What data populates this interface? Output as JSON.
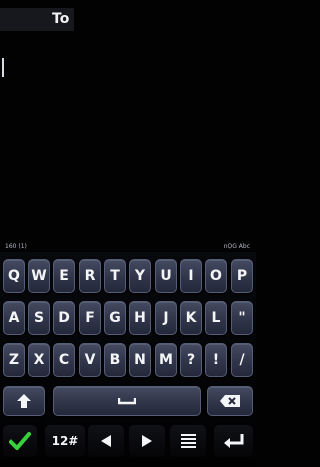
{
  "header": {
    "to_label": "To"
  },
  "keyboard": {
    "status_left": "160 (1)",
    "status_right": "nỌG Abc",
    "rows": [
      [
        "Q",
        "W",
        "E",
        "R",
        "T",
        "Y",
        "U",
        "I",
        "O",
        "P"
      ],
      [
        "A",
        "S",
        "D",
        "F",
        "G",
        "H",
        "J",
        "K",
        "L",
        "\""
      ],
      [
        "Z",
        "X",
        "C",
        "V",
        "B",
        "N",
        "M",
        "?",
        "!",
        "/"
      ]
    ],
    "mode_label": "12#",
    "icons": {
      "shift": "shift-arrow-icon",
      "space": "space-bar-icon",
      "backspace": "backspace-icon",
      "confirm": "checkmark-icon",
      "left": "left-arrow-icon",
      "right": "right-arrow-icon",
      "menu": "menu-icon",
      "enter": "enter-icon"
    },
    "colors": {
      "key_face": "#353b52",
      "key_border": "#565d77",
      "confirm": "#37d23b",
      "background": "#020203"
    }
  }
}
